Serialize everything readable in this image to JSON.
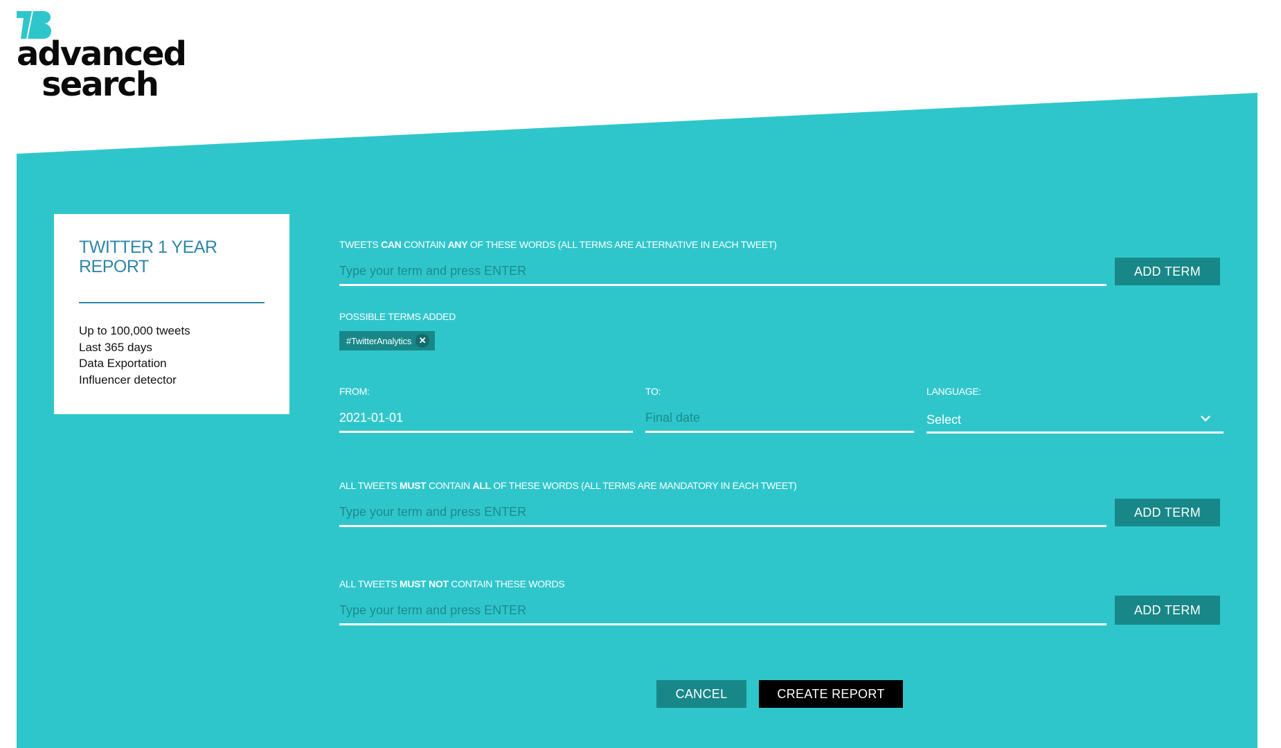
{
  "colors": {
    "panel": "#2fc6cb",
    "button_teal": "#188788",
    "button_primary": "#000000",
    "card_title": "#2f86a8",
    "placeholder": "#1b8b8c"
  },
  "logo": {
    "mark": "TB",
    "line1": "advanced",
    "line2": "search"
  },
  "plan_card": {
    "title": "TWITTER 1 YEAR REPORT",
    "features": [
      "Up to 100,000 tweets",
      "Last 365 days",
      "Data Exportation",
      "Influencer detector"
    ]
  },
  "any_words": {
    "label_parts": [
      "TWEETS ",
      "CAN",
      " CONTAIN ",
      "ANY",
      " OF THESE WORDS (ALL TERMS ARE ALTERNATIVE IN EACH TWEET)"
    ],
    "placeholder": "Type your term and press ENTER",
    "value": "",
    "button": "ADD TERM"
  },
  "terms_added": {
    "label": "POSSIBLE TERMS ADDED",
    "chips": [
      {
        "text": "#TwitterAnalytics",
        "remove_icon": "close-icon"
      }
    ]
  },
  "date_range": {
    "from_label": "FROM:",
    "from_value": "2021-01-01",
    "to_label": "TO:",
    "to_placeholder": "Final date",
    "to_value": ""
  },
  "language": {
    "label": "LANGUAGE:",
    "selected": "Select",
    "icon": "chevron-down-icon"
  },
  "all_words": {
    "label_parts": [
      "ALL TWEETS ",
      "MUST",
      " CONTAIN ",
      "ALL",
      " OF THESE WORDS (ALL TERMS ARE MANDATORY IN EACH TWEET)"
    ],
    "placeholder": "Type your term and press ENTER",
    "value": "",
    "button": "ADD TERM"
  },
  "excluded_words": {
    "label_parts": [
      "ALL TWEETS ",
      "MUST NOT",
      " CONTAIN THESE WORDS"
    ],
    "placeholder": "Type your term and press ENTER",
    "value": "",
    "button": "ADD TERM"
  },
  "actions": {
    "cancel": "CANCEL",
    "create": "CREATE REPORT"
  }
}
